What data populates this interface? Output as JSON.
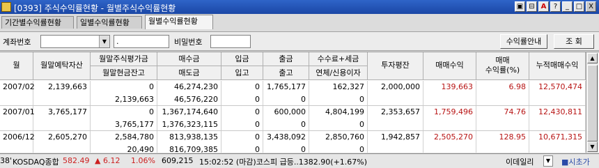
{
  "window": {
    "title": "[0393] 주식수익률현황 - 월별주식수익률현황",
    "buttons": [
      "▣",
      "⊟",
      "A",
      "?",
      "_",
      "□",
      "X"
    ]
  },
  "tabs": [
    {
      "label": "기간별수익률현황",
      "active": false
    },
    {
      "label": "일별수익률현황",
      "active": false
    },
    {
      "label": "월별수익률현황",
      "active": true
    }
  ],
  "search": {
    "account_label": "계좌번호",
    "account_value": "",
    "account_suffix": ".",
    "password_label": "비밀번호",
    "password_value": "",
    "guide_button": "수익률안내",
    "query_button": "조 회"
  },
  "table": {
    "headers": {
      "month": "월",
      "deposit": "월말예탁자산",
      "eval_top": "월말주식평가금",
      "eval_bottom": "월말현금잔고",
      "buy": "매수금",
      "sell": "매도금",
      "in": "입금",
      "in2": "입고",
      "out": "출금",
      "out2": "출고",
      "fee_top": "수수료+세금",
      "fee_bottom": "연체/신용이자",
      "avg": "투자평잔",
      "profit": "매매수익",
      "rate_top": "매매",
      "rate_bottom": "수익률(%)",
      "cum": "누적매매수익"
    },
    "rows": [
      {
        "month": "2007/02",
        "deposit": "2,139,663",
        "eval": "0",
        "cash": "2,139,663",
        "buy": "46,274,230",
        "sell": "46,576,220",
        "in": "0",
        "in2": "0",
        "out": "1,765,177",
        "out2": "0",
        "fee": "162,327",
        "interest": "0",
        "avg": "2,000,000",
        "profit": "139,663",
        "rate": "6.98",
        "cum": "12,570,474"
      },
      {
        "month": "2007/01",
        "deposit": "3,765,177",
        "eval": "0",
        "cash": "3,765,177",
        "buy": "1,367,174,640",
        "sell": "1,376,323,115",
        "in": "0",
        "in2": "0",
        "out": "600,000",
        "out2": "0",
        "fee": "4,804,199",
        "interest": "0",
        "avg": "2,353,657",
        "profit": "1,759,496",
        "rate": "74.76",
        "cum": "12,430,811"
      },
      {
        "month": "2006/12",
        "deposit": "2,605,270",
        "eval": "2,584,780",
        "cash": "20,490",
        "buy": "813,938,135",
        "sell": "816,709,385",
        "in": "0",
        "in2": "0",
        "out": "3,438,092",
        "out2": "0",
        "fee": "2,850,760",
        "interest": "0",
        "avg": "1,942,857",
        "profit": "2,505,270",
        "rate": "128.95",
        "cum": "10,671,315"
      }
    ]
  },
  "status": {
    "left_stub": "38'",
    "index_name": "KOSDAQ종합",
    "index_value": "582.49",
    "change": "▲ 6.12",
    "change_pct": "1.06%",
    "volume": "609,215",
    "news": "15:02:52 (마감)코스피 급등..1382.90(+1.67%)",
    "source": "이데일리",
    "ticker_stub": "■시초가"
  },
  "colors": {
    "profit": "#b81414",
    "title_bar": "#2456b8"
  }
}
